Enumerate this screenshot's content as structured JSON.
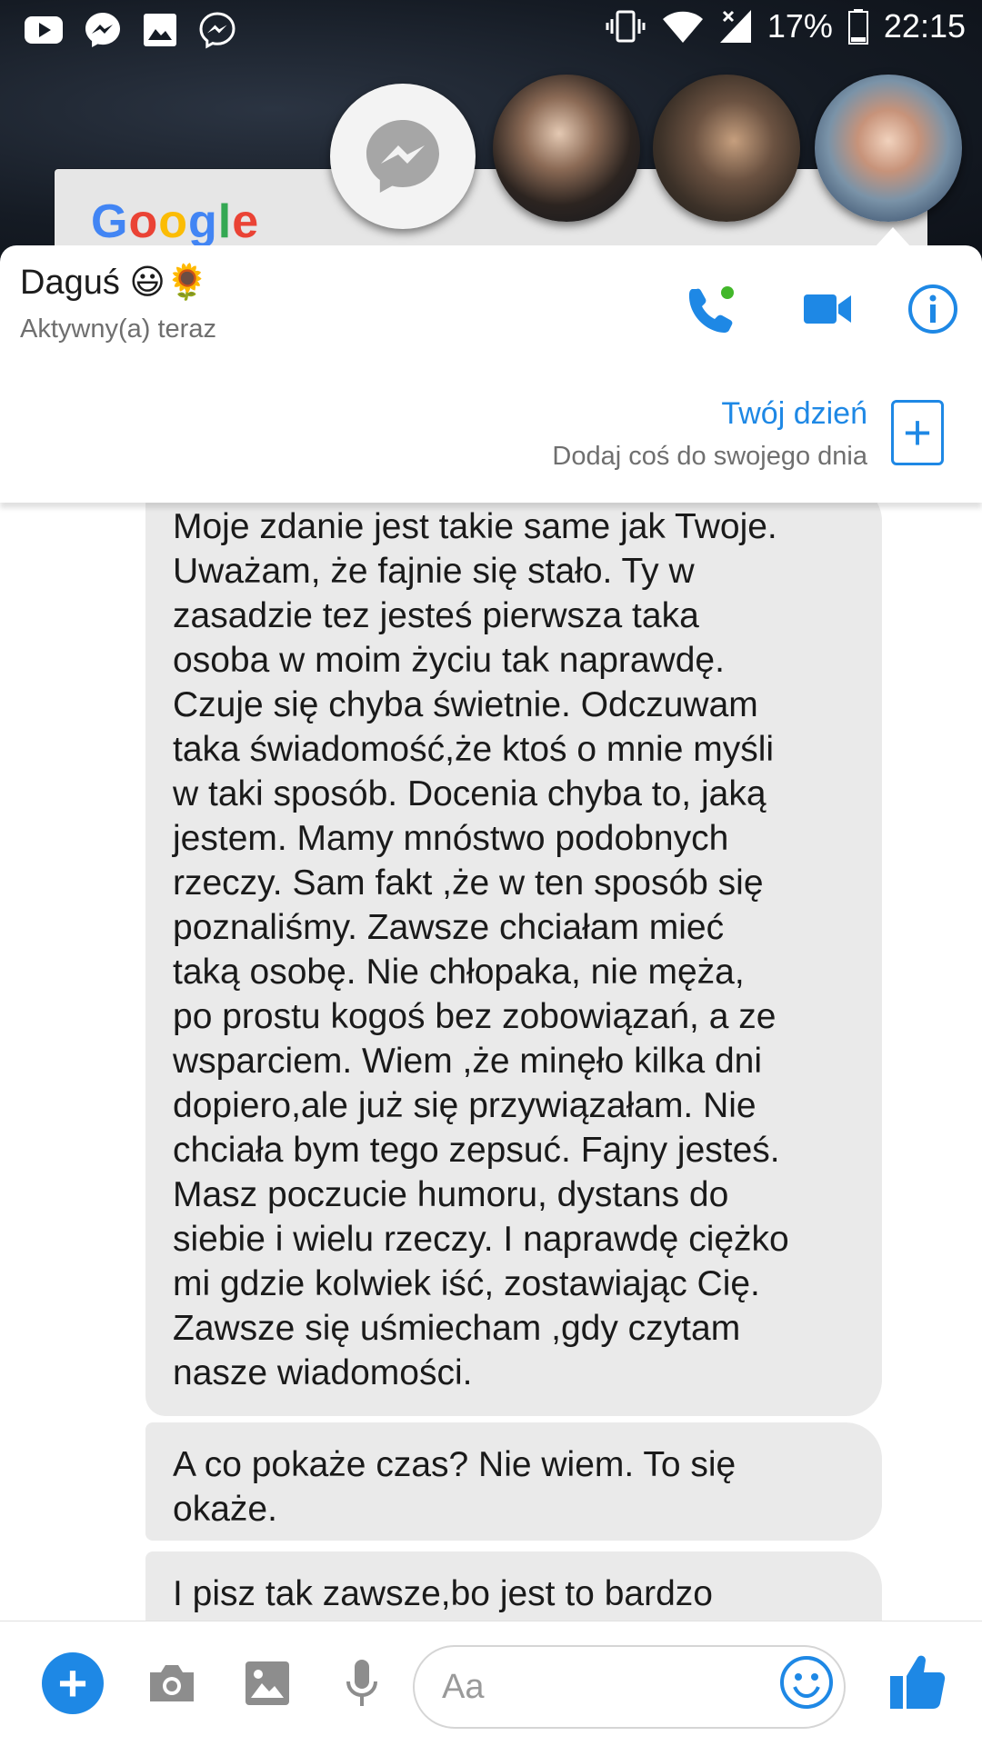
{
  "status_bar": {
    "battery": "17%",
    "time": "22:15",
    "icons": [
      "youtube-icon",
      "messenger-icon",
      "gallery-icon",
      "messenger-outline-icon",
      "vibrate-icon",
      "wifi-icon",
      "signal-icon",
      "battery-icon"
    ]
  },
  "widget": {
    "logo": "Google"
  },
  "chat_header": {
    "name": "Daguś 😃🌻",
    "status": "Aktywny(a) teraz",
    "accent": "#1e88e5",
    "story_title": "Twój dzień",
    "story_subtitle": "Dodaj coś do swojego dnia",
    "story_add": "+"
  },
  "messages": [
    {
      "text": "Moje zdanie jest takie same jak Twoje.\nUważam, że fajnie się stało.  Ty w\nzasadzie tez jesteś pierwsza taka\nosoba w moim życiu tak naprawdę.\nCzuje się chyba świetnie.  Odczuwam\ntaka świadomość,że ktoś o mnie myśli\nw taki sposób. Docenia chyba to, jaką\njestem. Mamy mnóstwo podobnych\nrzeczy. Sam fakt ,że w ten sposób się\npoznaliśmy.  Zawsze chciałam mieć\ntaką osobę.  Nie chłopaka,  nie męża,\npo prostu kogoś bez zobowiązań, a ze\nwsparciem.  Wiem ,że minęło  kilka dni\ndopiero,ale już się przywiązałam. Nie\nchciała bym tego zepsuć. Fajny jesteś.\nMasz poczucie humoru, dystans do\nsiebie i wielu rzeczy. I naprawdę  ciężko\nmi gdzie kolwiek iść, zostawiając Cię.\nZawsze się uśmiecham  ,gdy czytam\nnasze wiadomości."
    },
    {
      "text": "A co pokaże czas? Nie wiem. To się\nokaże."
    },
    {
      "text": "I pisz tak zawsze,bo jest to bardzo"
    }
  ],
  "composer": {
    "placeholder": "Aa",
    "value": "",
    "plus": "+",
    "icons": [
      "plus-icon",
      "camera-icon",
      "image-icon",
      "microphone-icon",
      "emoji-icon",
      "thumbs-up-icon"
    ]
  }
}
